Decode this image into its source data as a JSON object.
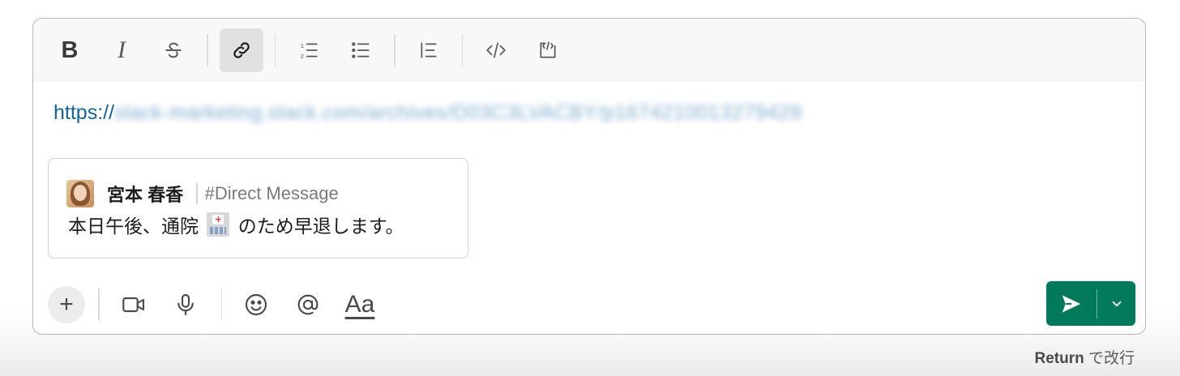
{
  "toolbar": {
    "bold_label": "B",
    "italic_label": "I",
    "icons": [
      "bold-icon",
      "italic-icon",
      "strikethrough-icon",
      "link-icon",
      "ordered-list-icon",
      "bulleted-list-icon",
      "blockquote-icon",
      "code-icon",
      "code-block-icon"
    ]
  },
  "message": {
    "link_prefix": "https://",
    "link_rest": "slack-marketing.slack.com/archives/D03C3LVACBY/p1674210013279429"
  },
  "quote": {
    "author": "宮本 春香",
    "channel": "#Direct Message",
    "text_before": "本日午後、通院",
    "text_after": "のため早退します。"
  },
  "bottom_bar": {
    "plus_label": "+",
    "format_label": "Aa",
    "icons": [
      "plus-icon",
      "video-icon",
      "microphone-icon",
      "emoji-icon",
      "mention-icon",
      "text-format-icon",
      "send-icon",
      "chevron-down-icon"
    ]
  },
  "hint": {
    "key": "Return",
    "text": " で改行"
  },
  "colors": {
    "send_button": "#007a5a",
    "link": "#1264a3",
    "toolbar_bg": "#f8f8f8"
  }
}
